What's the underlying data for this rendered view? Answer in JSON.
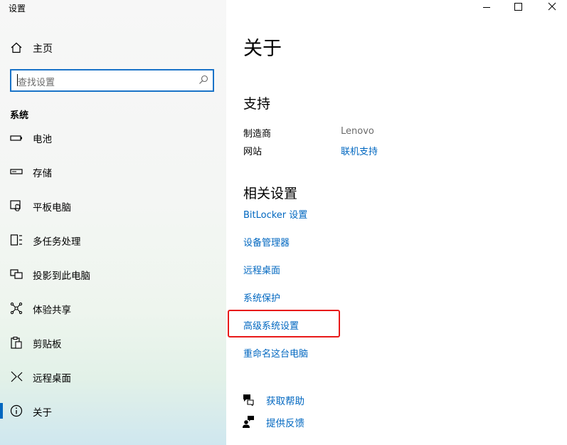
{
  "window": {
    "title": "设置",
    "controls": [
      "minimize-icon",
      "maximize-icon",
      "close-icon"
    ]
  },
  "sidebar": {
    "home_label": "主页",
    "search_placeholder": "查找设置",
    "group_title": "系统",
    "items": [
      {
        "label": "电池",
        "icon": "battery-icon"
      },
      {
        "label": "存储",
        "icon": "storage-icon"
      },
      {
        "label": "平板电脑",
        "icon": "tablet-icon"
      },
      {
        "label": "多任务处理",
        "icon": "multitasking-icon"
      },
      {
        "label": "投影到此电脑",
        "icon": "projecting-icon"
      },
      {
        "label": "体验共享",
        "icon": "shared-experiences-icon"
      },
      {
        "label": "剪贴板",
        "icon": "clipboard-icon"
      },
      {
        "label": "远程桌面",
        "icon": "remote-desktop-icon"
      },
      {
        "label": "关于",
        "icon": "info-icon",
        "active": true
      }
    ]
  },
  "main": {
    "title": "关于",
    "support": {
      "title": "支持",
      "rows": [
        {
          "label": "制造商",
          "value": "Lenovo"
        },
        {
          "label": "网站",
          "value": "联机支持"
        }
      ]
    },
    "related": {
      "title": "相关设置",
      "links": [
        "BitLocker 设置",
        "设备管理器",
        "远程桌面",
        "系统保护",
        "高级系统设置",
        "重命名这台电脑"
      ],
      "highlighted": "高级系统设置"
    },
    "help": {
      "get_help": "获取帮助",
      "feedback": "提供反馈"
    }
  },
  "colors": {
    "accent": "#0067c0",
    "highlight_border": "#e81a1a",
    "search_border": "#1a73c8"
  }
}
